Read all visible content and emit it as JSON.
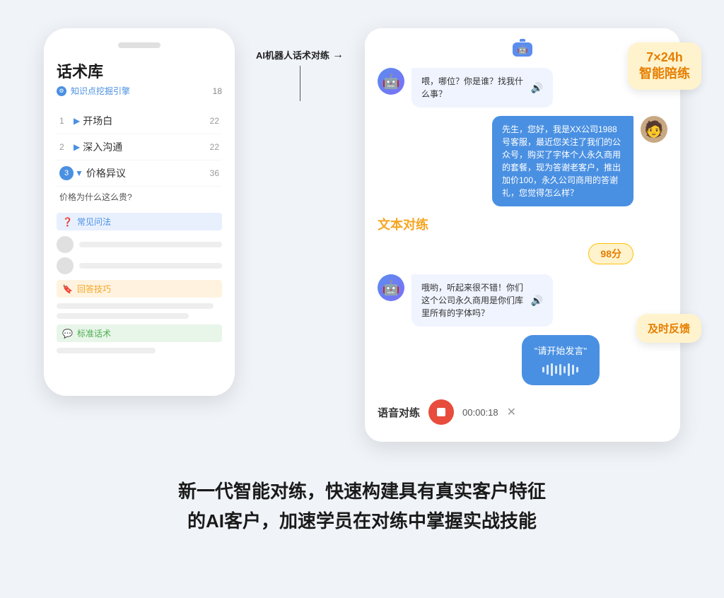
{
  "page": {
    "bg_color": "#f0f4f8"
  },
  "left_phone": {
    "notch": true,
    "title": "话术库",
    "subtitle_icon": "⚙",
    "subtitle_text": "知识点挖掘引擎",
    "subtitle_count": "18",
    "menu_items": [
      {
        "num": "1",
        "label": "开场白",
        "count": "22",
        "active": false
      },
      {
        "num": "2",
        "label": "深入沟通",
        "count": "22",
        "active": false
      },
      {
        "num": "3",
        "label": "价格异议",
        "count": "36",
        "active": true
      }
    ],
    "sub_question": "价格为什么这么贵?",
    "section_faq": "常见问法",
    "section_tips": "回答技巧",
    "section_standard": "标准话术"
  },
  "arrow": {
    "label": "AI机器人话术对练"
  },
  "chat": {
    "header_label": "AI机器人话术对练",
    "msg1_bot": "喂，哪位？你是谁？找我什么事？",
    "msg2_user": "先生，您好，我是XX公司1988号客服，最近您关注了我们的公众号，购买了字体个人永久商用的套餐，现为答谢老客户，推出加价100，永久公司商用的答谢礼，您觉得怎么样？",
    "msg3_bot": "哦哟，听起来很不错！你们这个公司永久商用是你们库里所有的字体吗？",
    "score": "98分",
    "voice_text": "\"请开始发言\"",
    "voice_label": "语音对练",
    "text_label": "文本对练",
    "timer": "00:00:18",
    "badge_24h": "7×24h\n智能陪练",
    "badge_feedback": "及时反馈"
  },
  "bottom": {
    "line1": "新一代智能对练，快速构建具有真实客户特征",
    "line2": "的AI客户，加速学员在对练中掌握实战技能"
  }
}
